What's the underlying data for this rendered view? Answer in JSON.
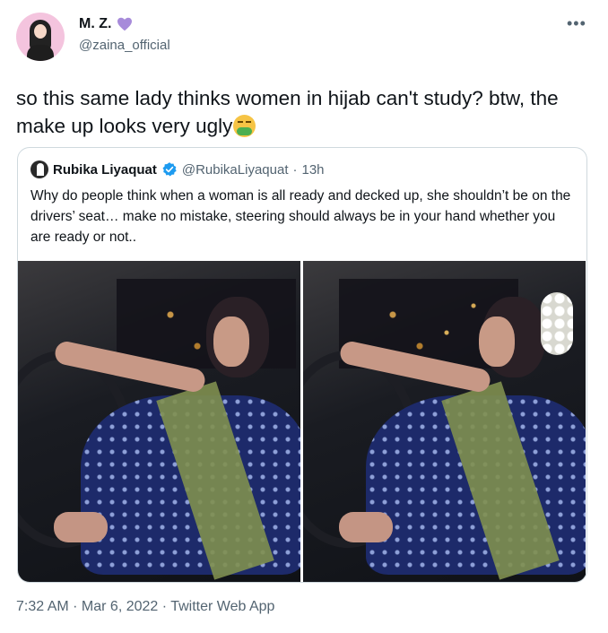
{
  "author": {
    "display_name": "M. Z.",
    "handle": "@zaina_official",
    "name_badge_icon": "purple-heart-icon"
  },
  "tweet": {
    "text": "so this same lady thinks women in hijab can't study? btw, the make up looks very ugly",
    "emoji": "nauseated-face-emoji"
  },
  "quoted_tweet": {
    "author_name": "Rubika Liyaquat",
    "verified_icon": "verified-badge-icon",
    "handle": "@RubikaLiyaquat",
    "separator": "·",
    "time_ago": "13h",
    "text": "Why do people think when a woman is all ready and decked up, she shouldn’t be on the drivers’ seat… make no mistake, steering should always be in your hand whether you are ready or not.."
  },
  "meta": {
    "timestamp": "7:32 AM · Mar 6, 2022 · Twitter Web App"
  },
  "colors": {
    "text_primary": "#0f1419",
    "text_secondary": "#536471",
    "border": "#cfd9de",
    "verified_blue": "#1d9bf0",
    "heart_purple": "#a78bda"
  }
}
